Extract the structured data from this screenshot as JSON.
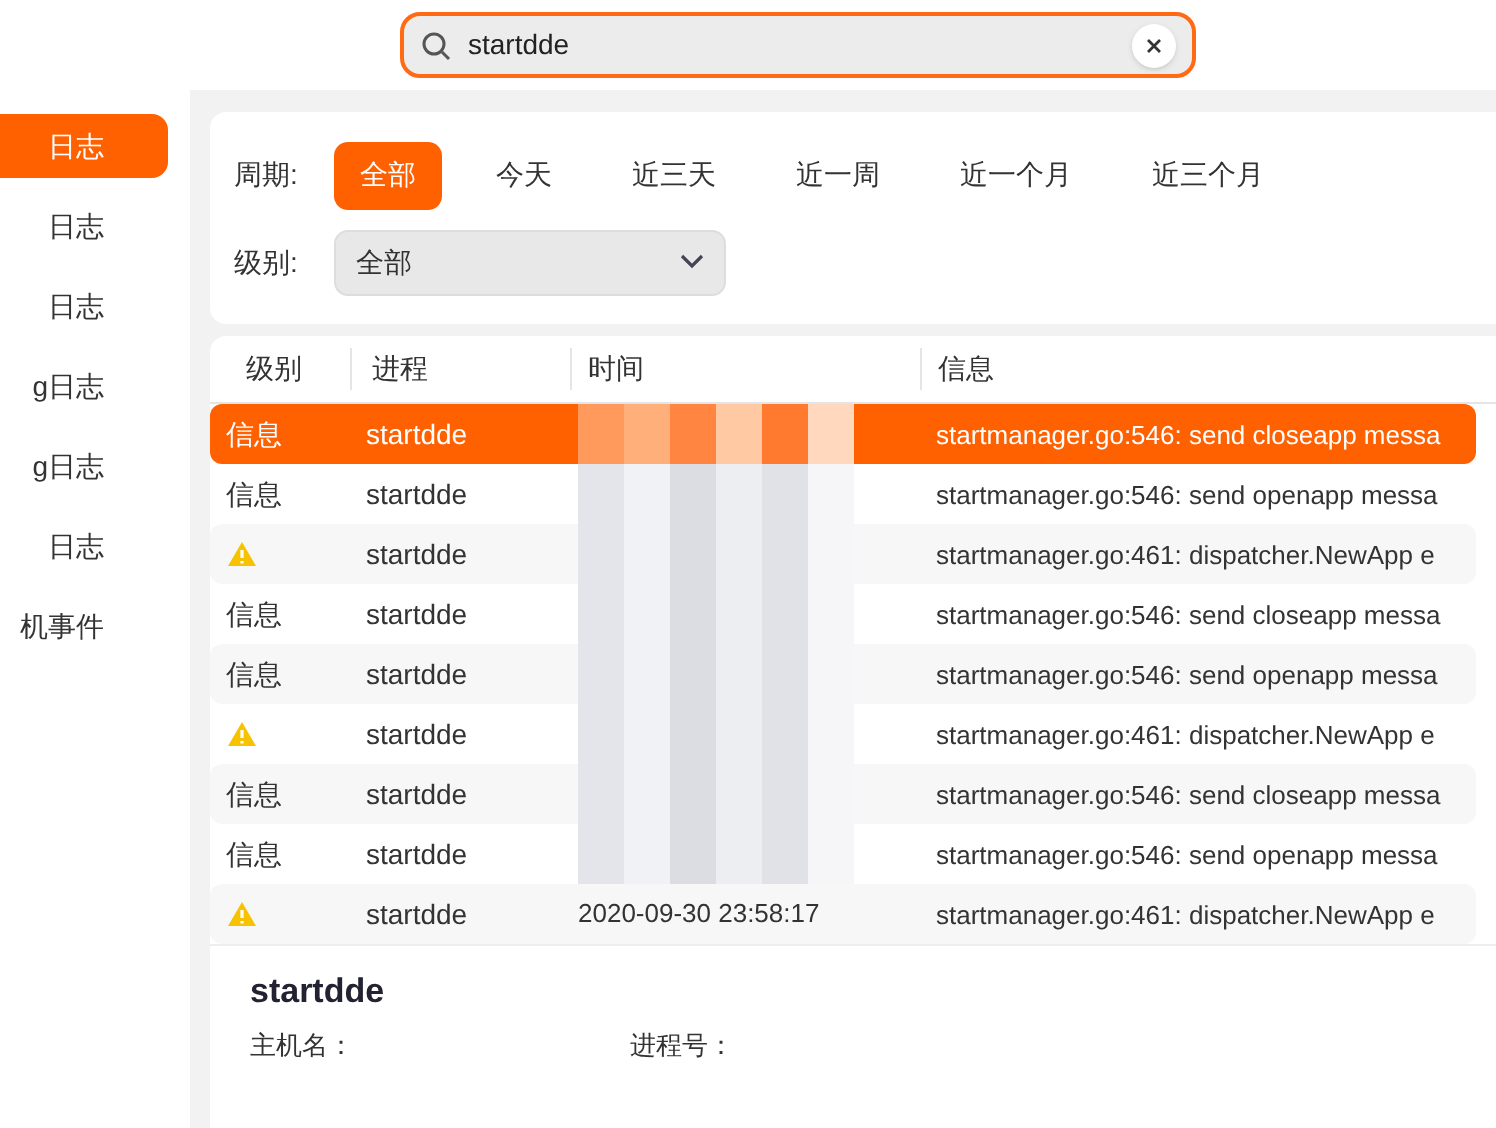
{
  "search": {
    "value": "startdde",
    "focused": true
  },
  "sidebar": {
    "items": [
      {
        "label": "日志",
        "selected": true
      },
      {
        "label": "日志",
        "selected": false
      },
      {
        "label": "日志",
        "selected": false
      },
      {
        "label": "g日志",
        "selected": false
      },
      {
        "label": "g日志",
        "selected": false
      },
      {
        "label": "日志",
        "selected": false
      },
      {
        "label": "机事件",
        "selected": false
      }
    ]
  },
  "filters": {
    "period_label": "周期:",
    "periods": [
      {
        "label": "全部",
        "selected": true
      },
      {
        "label": "今天",
        "selected": false
      },
      {
        "label": "近三天",
        "selected": false
      },
      {
        "label": "近一周",
        "selected": false
      },
      {
        "label": "近一个月",
        "selected": false
      },
      {
        "label": "近三个月",
        "selected": false
      }
    ],
    "level_label": "级别:",
    "level_value": "全部"
  },
  "table": {
    "columns": [
      "级别",
      "进程",
      "时间",
      "信息"
    ],
    "rows": [
      {
        "kind": "info",
        "level": "信息",
        "process": "startdde",
        "info": "startmanager.go:546: send closeapp messa",
        "selected": true
      },
      {
        "kind": "info",
        "level": "信息",
        "process": "startdde",
        "info": "startmanager.go:546: send openapp messa",
        "selected": false
      },
      {
        "kind": "warning",
        "process": "startdde",
        "info": "startmanager.go:461: dispatcher.NewApp e",
        "selected": false
      },
      {
        "kind": "info",
        "level": "信息",
        "process": "startdde",
        "info": "startmanager.go:546: send closeapp messa",
        "selected": false
      },
      {
        "kind": "info",
        "level": "信息",
        "process": "startdde",
        "info": "startmanager.go:546: send openapp messa",
        "selected": false
      },
      {
        "kind": "warning",
        "process": "startdde",
        "info": "startmanager.go:461: dispatcher.NewApp e",
        "selected": false
      },
      {
        "kind": "info",
        "level": "信息",
        "process": "startdde",
        "info": "startmanager.go:546: send closeapp messa",
        "selected": false
      },
      {
        "kind": "info",
        "level": "信息",
        "process": "startdde",
        "info": "startmanager.go:546: send openapp messa",
        "selected": false
      },
      {
        "kind": "warning",
        "process": "startdde",
        "time": "2020-09-30 23:58:17",
        "info": "startmanager.go:461: dispatcher.NewApp e",
        "selected": false
      }
    ]
  },
  "detail": {
    "title": "startdde",
    "host_label": "主机名：",
    "pid_label": "进程号："
  }
}
